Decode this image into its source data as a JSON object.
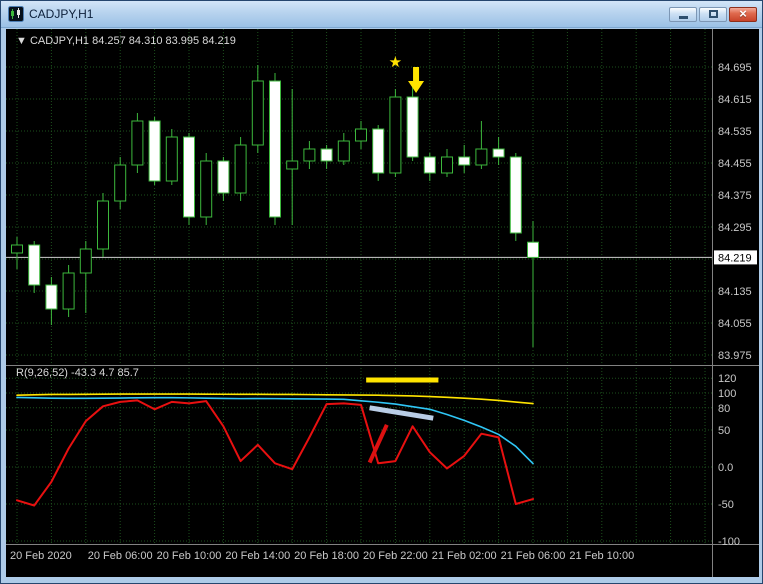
{
  "window": {
    "title": "CADJPY,H1",
    "close_glyph": "×"
  },
  "colors": {
    "background": "#000000",
    "grid": "#1d4f1d",
    "bull": "#000000",
    "bear": "#ffffff",
    "candle_outline": "#3cb83c",
    "axis_text": "#c9c9c9",
    "separator": "#828282",
    "current_price_line": "#cfcfcf",
    "price_box_bg": "#ffffff",
    "price_box_text": "#000000",
    "header_text": "#d9d9d9",
    "yellow_line": "#ffe400",
    "cyan_line": "#2fc6f6",
    "red_line": "#e81010",
    "annotation_yellow": "#ffe400",
    "annotation_blue": "#b9cde6",
    "annotation_red": "#dd1111"
  },
  "chart_header": {
    "marker": "▼",
    "symbol": "CADJPY,H1",
    "open": "84.257",
    "high": "84.310",
    "low": "83.995",
    "close": "84.219"
  },
  "indicator_header": {
    "name": "R(9,26,52)",
    "values": "-43.3 4.7 85.7"
  },
  "time_axis": {
    "labels": [
      {
        "text": "20 Feb 2020",
        "index": 0
      },
      {
        "text": "20 Feb 06:00",
        "index": 6
      },
      {
        "text": "20 Feb 10:00",
        "index": 10
      },
      {
        "text": "20 Feb 14:00",
        "index": 14
      },
      {
        "text": "20 Feb 18:00",
        "index": 18
      },
      {
        "text": "20 Feb 22:00",
        "index": 22
      },
      {
        "text": "21 Feb 02:00",
        "index": 26
      },
      {
        "text": "21 Feb 06:00",
        "index": 30
      },
      {
        "text": "21 Feb 10:00",
        "index": 34
      }
    ]
  },
  "chart_data": [
    {
      "type": "candlestick",
      "symbol": "CADJPY",
      "timeframe": "H1",
      "price_range": [
        83.975,
        84.695
      ],
      "current_price": 84.219,
      "current_price_label": "84.219",
      "grid_prices": [
        {
          "value": 84.695,
          "label": "84.695"
        },
        {
          "value": 84.615,
          "label": "84.615"
        },
        {
          "value": 84.535,
          "label": "84.535"
        },
        {
          "value": 84.455,
          "label": "84.455"
        },
        {
          "value": 84.375,
          "label": "84.375"
        },
        {
          "value": 84.295,
          "label": "84.295"
        },
        {
          "value": 84.215,
          "label": ""
        },
        {
          "value": 84.135,
          "label": "84.135"
        },
        {
          "value": 84.055,
          "label": "84.055"
        },
        {
          "value": 83.975,
          "label": "83.975"
        }
      ],
      "candles": [
        {
          "t": "20 Feb 00:00",
          "o": 84.23,
          "h": 84.27,
          "l": 84.19,
          "c": 84.25
        },
        {
          "t": "20 Feb 01:00",
          "o": 84.25,
          "h": 84.26,
          "l": 84.13,
          "c": 84.15
        },
        {
          "t": "20 Feb 02:00",
          "o": 84.15,
          "h": 84.17,
          "l": 84.05,
          "c": 84.09
        },
        {
          "t": "20 Feb 03:00",
          "o": 84.09,
          "h": 84.2,
          "l": 84.07,
          "c": 84.18
        },
        {
          "t": "20 Feb 04:00",
          "o": 84.18,
          "h": 84.26,
          "l": 84.08,
          "c": 84.24
        },
        {
          "t": "20 Feb 05:00",
          "o": 84.24,
          "h": 84.38,
          "l": 84.22,
          "c": 84.36
        },
        {
          "t": "20 Feb 06:00",
          "o": 84.36,
          "h": 84.47,
          "l": 84.34,
          "c": 84.45
        },
        {
          "t": "20 Feb 07:00",
          "o": 84.45,
          "h": 84.58,
          "l": 84.43,
          "c": 84.56
        },
        {
          "t": "20 Feb 08:00",
          "o": 84.56,
          "h": 84.57,
          "l": 84.4,
          "c": 84.41
        },
        {
          "t": "20 Feb 09:00",
          "o": 84.41,
          "h": 84.54,
          "l": 84.4,
          "c": 84.52
        },
        {
          "t": "20 Feb 10:00",
          "o": 84.52,
          "h": 84.53,
          "l": 84.3,
          "c": 84.32
        },
        {
          "t": "20 Feb 11:00",
          "o": 84.32,
          "h": 84.48,
          "l": 84.3,
          "c": 84.46
        },
        {
          "t": "20 Feb 12:00",
          "o": 84.46,
          "h": 84.47,
          "l": 84.36,
          "c": 84.38
        },
        {
          "t": "20 Feb 13:00",
          "o": 84.38,
          "h": 84.52,
          "l": 84.36,
          "c": 84.5
        },
        {
          "t": "20 Feb 14:00",
          "o": 84.5,
          "h": 84.7,
          "l": 84.48,
          "c": 84.66
        },
        {
          "t": "20 Feb 15:00",
          "o": 84.66,
          "h": 84.68,
          "l": 84.3,
          "c": 84.32
        },
        {
          "t": "20 Feb 16:00",
          "o": 84.44,
          "h": 84.64,
          "l": 84.3,
          "c": 84.46
        },
        {
          "t": "20 Feb 17:00",
          "o": 84.46,
          "h": 84.51,
          "l": 84.44,
          "c": 84.49
        },
        {
          "t": "20 Feb 18:00",
          "o": 84.49,
          "h": 84.5,
          "l": 84.44,
          "c": 84.46
        },
        {
          "t": "20 Feb 19:00",
          "o": 84.46,
          "h": 84.53,
          "l": 84.45,
          "c": 84.51
        },
        {
          "t": "20 Feb 20:00",
          "o": 84.51,
          "h": 84.56,
          "l": 84.49,
          "c": 84.54
        },
        {
          "t": "20 Feb 21:00",
          "o": 84.54,
          "h": 84.55,
          "l": 84.41,
          "c": 84.43
        },
        {
          "t": "20 Feb 22:00",
          "o": 84.43,
          "h": 84.64,
          "l": 84.42,
          "c": 84.62
        },
        {
          "t": "20 Feb 23:00",
          "o": 84.62,
          "h": 84.66,
          "l": 84.46,
          "c": 84.47
        },
        {
          "t": "21 Feb 00:00",
          "o": 84.47,
          "h": 84.48,
          "l": 84.41,
          "c": 84.43
        },
        {
          "t": "21 Feb 01:00",
          "o": 84.43,
          "h": 84.49,
          "l": 84.42,
          "c": 84.47
        },
        {
          "t": "21 Feb 02:00",
          "o": 84.47,
          "h": 84.5,
          "l": 84.43,
          "c": 84.45
        },
        {
          "t": "21 Feb 03:00",
          "o": 84.45,
          "h": 84.56,
          "l": 84.44,
          "c": 84.49
        },
        {
          "t": "21 Feb 04:00",
          "o": 84.49,
          "h": 84.52,
          "l": 84.45,
          "c": 84.47
        },
        {
          "t": "21 Feb 05:00",
          "o": 84.47,
          "h": 84.48,
          "l": 84.26,
          "c": 84.28
        },
        {
          "t": "21 Feb 06:00",
          "o": 84.257,
          "h": 84.31,
          "l": 83.995,
          "c": 84.219
        }
      ],
      "annotations": [
        {
          "type": "star",
          "glyph": "★",
          "x_index": 22.0,
          "price": 84.695
        },
        {
          "type": "arrow_down",
          "x_index": 23.2,
          "price_top": 84.695,
          "price_tip": 84.63
        }
      ]
    },
    {
      "type": "line",
      "name": "R(9,26,52)",
      "levels": [
        {
          "value": 120,
          "label": "120"
        },
        {
          "value": 100,
          "label": "100"
        },
        {
          "value": 80,
          "label": "80"
        },
        {
          "value": 50,
          "label": "50"
        },
        {
          "value": 0,
          "label": "0.0"
        },
        {
          "value": -50,
          "label": "-50"
        },
        {
          "value": -100,
          "label": "-100"
        }
      ],
      "series": [
        {
          "name": "yellow",
          "color_key": "yellow_line",
          "width": 1.6,
          "values": [
            97,
            97.5,
            98,
            98,
            98.2,
            98.4,
            98.5,
            98.6,
            98.6,
            98.6,
            98.5,
            98.4,
            98.3,
            98.2,
            98.2,
            98.1,
            98,
            97.8,
            97.6,
            97.4,
            97.2,
            97,
            96.6,
            96,
            95.2,
            94.2,
            93,
            91.6,
            90,
            87.8,
            85.7
          ]
        },
        {
          "name": "cyan",
          "color_key": "cyan_line",
          "width": 1.6,
          "values": [
            94,
            93.5,
            93,
            92.8,
            92.8,
            93,
            93.2,
            93.5,
            93.6,
            93.6,
            93.4,
            93,
            92.6,
            92.4,
            92.5,
            92.4,
            92.2,
            92,
            91.8,
            91.5,
            89.5,
            87.5,
            85,
            81.5,
            78,
            71,
            63,
            54,
            44,
            28,
            4.7
          ]
        },
        {
          "name": "red",
          "color_key": "red_line",
          "width": 2,
          "values": [
            -45,
            -52,
            -20,
            25,
            62,
            82,
            88,
            90,
            78,
            88,
            86,
            89,
            55,
            8,
            30,
            5,
            -3,
            40,
            85,
            86,
            84,
            5,
            8,
            55,
            20,
            -2,
            15,
            45,
            40,
            -50,
            -43.3
          ]
        }
      ],
      "annotations": [
        {
          "type": "segment",
          "name": "yellow-highlight-segment",
          "color_key": "annotation_yellow",
          "width": 5,
          "from_index": 20.3,
          "from_value": 117.5,
          "to_index": 24.5,
          "to_value": 117.5
        },
        {
          "type": "segment",
          "name": "blue-highlight-segment",
          "color_key": "annotation_blue",
          "width": 5,
          "from_index": 20.5,
          "from_value": 80,
          "to_index": 24.2,
          "to_value": 66
        },
        {
          "type": "segment",
          "name": "red-highlight-segment",
          "color_key": "annotation_red",
          "width": 4,
          "from_index": 20.5,
          "from_value": 6,
          "to_index": 21.5,
          "to_value": 57
        }
      ]
    }
  ]
}
